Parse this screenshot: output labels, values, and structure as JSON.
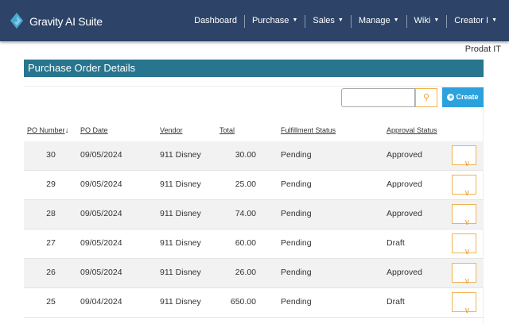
{
  "app": {
    "title": "Gravity AI Suite",
    "user": "Prodat IT"
  },
  "nav": [
    {
      "label": "Dashboard",
      "caret": false
    },
    {
      "label": "Purchase",
      "caret": true
    },
    {
      "label": "Sales",
      "caret": true
    },
    {
      "label": "Manage",
      "caret": true
    },
    {
      "label": "Wiki",
      "caret": true
    },
    {
      "label": "Creator I",
      "caret": true
    }
  ],
  "panel": {
    "title": "Purchase Order Details"
  },
  "toolbar": {
    "search_value": "",
    "create_label": "Create"
  },
  "table": {
    "headers": [
      "PO Number",
      "PO Date",
      "Vendor",
      "Total",
      "Fulfillment Status",
      "Approval Status"
    ],
    "rows": [
      [
        "30",
        "09/05/2024",
        "911 Disney",
        "30.00",
        "Pending",
        "Approved"
      ],
      [
        "29",
        "09/05/2024",
        "911 Disney",
        "25.00",
        "Pending",
        "Approved"
      ],
      [
        "28",
        "09/05/2024",
        "911 Disney",
        "74.00",
        "Pending",
        "Approved"
      ],
      [
        "27",
        "09/05/2024",
        "911 Disney",
        "60.00",
        "Pending",
        "Draft"
      ],
      [
        "26",
        "09/05/2024",
        "911 Disney",
        "26.00",
        "Pending",
        "Approved"
      ],
      [
        "25",
        "09/04/2024",
        "911 Disney",
        "650.00",
        "Pending",
        "Draft"
      ]
    ]
  }
}
